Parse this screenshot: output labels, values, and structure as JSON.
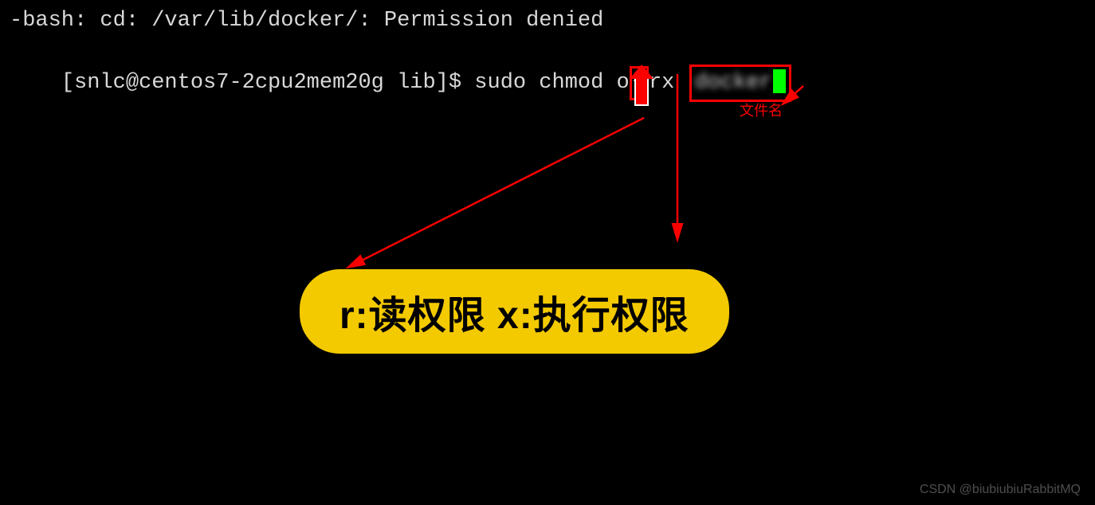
{
  "terminal": {
    "line1": "-bash: cd: /var/lib/docker/: Permission denied",
    "prompt": "[snlc@centos7-2cpu2mem20g lib]$ ",
    "command_part1": "sudo chmod o",
    "plus": "+",
    "command_part2": "rx ",
    "filename_blurred": "docker"
  },
  "annotations": {
    "filename_label": "文件名",
    "permissions_badge": "r:读权限  x:执行权限"
  },
  "watermark": "CSDN @biubiubiuRabbitMQ"
}
